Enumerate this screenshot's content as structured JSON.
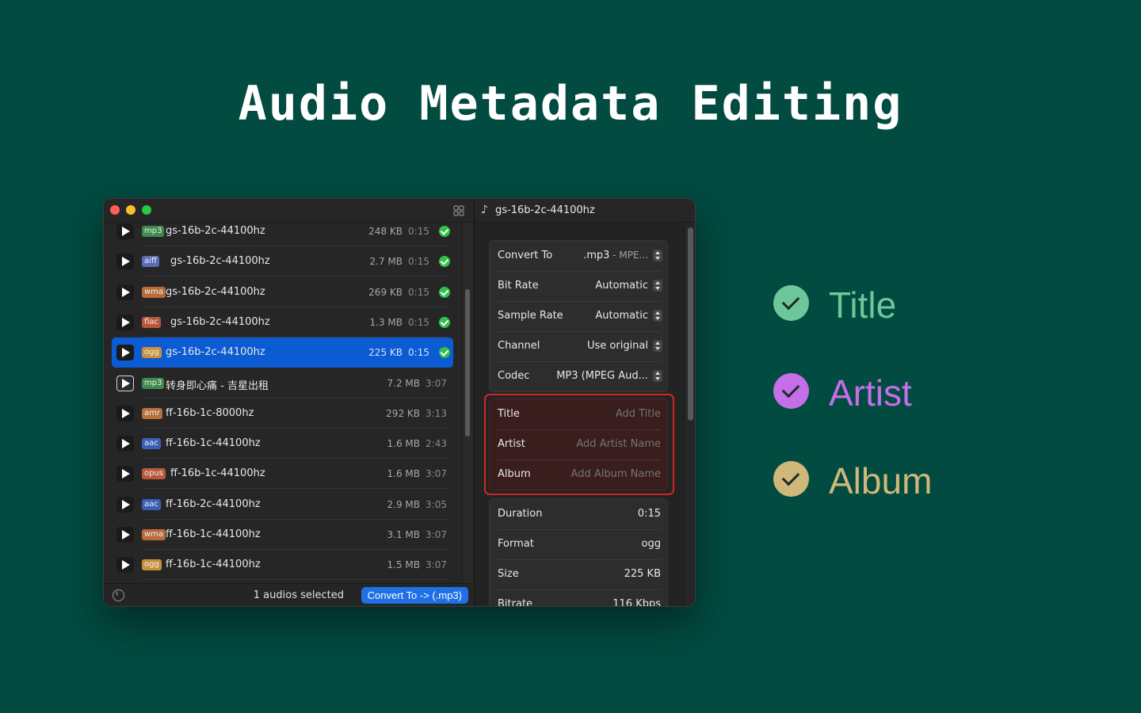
{
  "headline": "Audio Metadata Editing",
  "window": {
    "files": [
      {
        "format": "mp3",
        "format_color": "#3f8a4e",
        "name": "gs-16b-2c-44100hz",
        "size": "248 KB",
        "duration": "0:15",
        "done": true,
        "selected": false,
        "focus": false
      },
      {
        "format": "aiff",
        "format_color": "#5a6bb8",
        "name": "gs-16b-2c-44100hz",
        "size": "2.7 MB",
        "duration": "0:15",
        "done": true,
        "selected": false,
        "focus": false
      },
      {
        "format": "wma",
        "format_color": "#b86a3a",
        "name": "gs-16b-2c-44100hz",
        "size": "269 KB",
        "duration": "0:15",
        "done": true,
        "selected": false,
        "focus": false
      },
      {
        "format": "flac",
        "format_color": "#b8573a",
        "name": "gs-16b-2c-44100hz",
        "size": "1.3 MB",
        "duration": "0:15",
        "done": true,
        "selected": false,
        "focus": false
      },
      {
        "format": "ogg",
        "format_color": "#c8903a",
        "name": "gs-16b-2c-44100hz",
        "size": "225 KB",
        "duration": "0:15",
        "done": true,
        "selected": true,
        "focus": false
      },
      {
        "format": "mp3",
        "format_color": "#3f8a4e",
        "name": "转身即心痛 - 吉星出租",
        "size": "7.2 MB",
        "duration": "3:07",
        "done": false,
        "selected": false,
        "focus": true
      },
      {
        "format": "amr",
        "format_color": "#b8703a",
        "name": "ff-16b-1c-8000hz",
        "size": "292 KB",
        "duration": "3:13",
        "done": false,
        "selected": false,
        "focus": false
      },
      {
        "format": "aac",
        "format_color": "#3a5fb8",
        "name": "ff-16b-1c-44100hz",
        "size": "1.6 MB",
        "duration": "2:43",
        "done": false,
        "selected": false,
        "focus": false
      },
      {
        "format": "opus",
        "format_color": "#b85a3a",
        "name": "ff-16b-1c-44100hz",
        "size": "1.6 MB",
        "duration": "3:07",
        "done": false,
        "selected": false,
        "focus": false
      },
      {
        "format": "aac",
        "format_color": "#3a5fb8",
        "name": "ff-16b-2c-44100hz",
        "size": "2.9 MB",
        "duration": "3:05",
        "done": false,
        "selected": false,
        "focus": false
      },
      {
        "format": "wma",
        "format_color": "#b86a3a",
        "name": "ff-16b-1c-44100hz",
        "size": "3.1 MB",
        "duration": "3:07",
        "done": false,
        "selected": false,
        "focus": false
      },
      {
        "format": "ogg",
        "format_color": "#c8903a",
        "name": "ff-16b-1c-44100hz",
        "size": "1.5 MB",
        "duration": "3:07",
        "done": false,
        "selected": false,
        "focus": false
      }
    ],
    "footer": {
      "selected_count": "1 audios selected",
      "convert_button": "Convert To -> (.mp3)"
    },
    "inspector": {
      "title": "gs-16b-2c-44100hz",
      "conversion": [
        {
          "label": "Convert To",
          "value": ".mp3",
          "sub": " - MPE..."
        },
        {
          "label": "Bit Rate",
          "value": "Automatic",
          "sub": ""
        },
        {
          "label": "Sample Rate",
          "value": "Automatic",
          "sub": ""
        },
        {
          "label": "Channel",
          "value": "Use original",
          "sub": ""
        },
        {
          "label": "Codec",
          "value": "MP3 (MPEG Aud...",
          "sub": ""
        }
      ],
      "metadata": [
        {
          "label": "Title",
          "placeholder": "Add Title"
        },
        {
          "label": "Artist",
          "placeholder": "Add Artist Name"
        },
        {
          "label": "Album",
          "placeholder": "Add Album Name"
        }
      ],
      "info": [
        {
          "label": "Duration",
          "value": "0:15"
        },
        {
          "label": "Format",
          "value": "ogg"
        },
        {
          "label": "Size",
          "value": "225 KB"
        },
        {
          "label": "Bitrate",
          "value": "116 Kbps"
        }
      ]
    }
  },
  "features": [
    {
      "label": "Title",
      "color": "#6cc79a"
    },
    {
      "label": "Artist",
      "color": "#c46ee8"
    },
    {
      "label": "Album",
      "color": "#d0b77a"
    }
  ]
}
